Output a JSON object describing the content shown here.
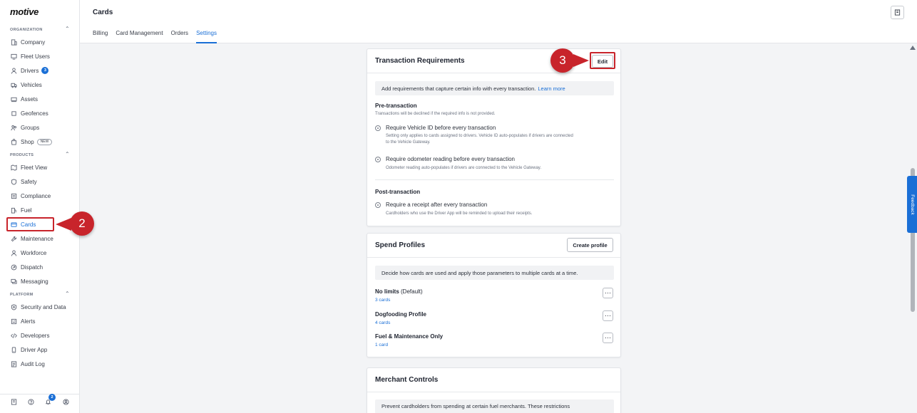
{
  "app": {
    "logo": "motive"
  },
  "sidebar": {
    "sections": [
      {
        "label": "ORGANIZATION"
      },
      {
        "label": "PRODUCTS"
      },
      {
        "label": "PLATFORM"
      }
    ],
    "organization_items": [
      {
        "label": "Company",
        "icon": "building-icon"
      },
      {
        "label": "Fleet Users",
        "icon": "monitor-icon"
      },
      {
        "label": "Drivers",
        "icon": "person-icon",
        "badge": "3"
      },
      {
        "label": "Vehicles",
        "icon": "truck-icon"
      },
      {
        "label": "Assets",
        "icon": "trailer-icon"
      },
      {
        "label": "Geofences",
        "icon": "geofence-icon"
      },
      {
        "label": "Groups",
        "icon": "groups-icon"
      },
      {
        "label": "Shop",
        "icon": "shop-icon",
        "tag": "NEW"
      }
    ],
    "products_items": [
      {
        "label": "Fleet View",
        "icon": "map-icon"
      },
      {
        "label": "Safety",
        "icon": "shield-icon"
      },
      {
        "label": "Compliance",
        "icon": "compliance-icon"
      },
      {
        "label": "Fuel",
        "icon": "fuel-icon"
      },
      {
        "label": "Cards",
        "icon": "card-icon",
        "active": true
      },
      {
        "label": "Maintenance",
        "icon": "wrench-icon"
      },
      {
        "label": "Workforce",
        "icon": "person-icon"
      },
      {
        "label": "Dispatch",
        "icon": "dispatch-icon"
      },
      {
        "label": "Messaging",
        "icon": "chat-icon"
      }
    ],
    "platform_items": [
      {
        "label": "Security and Data",
        "icon": "shield-lock-icon"
      },
      {
        "label": "Alerts",
        "icon": "alert-icon"
      },
      {
        "label": "Developers",
        "icon": "code-icon"
      },
      {
        "label": "Driver App",
        "icon": "phone-icon"
      },
      {
        "label": "Audit Log",
        "icon": "log-icon"
      }
    ],
    "bottom": {
      "notification_count": "2"
    }
  },
  "header": {
    "title": "Cards",
    "tabs": [
      {
        "label": "Billing"
      },
      {
        "label": "Card Management"
      },
      {
        "label": "Orders"
      },
      {
        "label": "Settings",
        "active": true
      }
    ]
  },
  "transaction_requirements": {
    "title": "Transaction Requirements",
    "edit_label": "Edit",
    "info": "Add requirements that capture certain info with every transaction.",
    "learn_more": "Learn more",
    "pre_title": "Pre-transaction",
    "pre_note": "Transactions will be declined if the required info is not provided.",
    "req1_label": "Require Vehicle ID before every transaction",
    "req1_note_1": "Setting only applies to cards assigned to drivers. Vehicle ID auto-populates if drivers are connected",
    "req1_note_2": "to the Vehicle Gateway.",
    "req2_label": "Require odometer reading before every transaction",
    "req2_note": "Odometer reading auto-populates if drivers are connected to the Vehicle Gateway.",
    "post_title": "Post-transaction",
    "req3_label": "Require a receipt after every transaction",
    "req3_note": "Cardholders who use the Driver App will be reminded to upload their receipts."
  },
  "spend_profiles": {
    "title": "Spend Profiles",
    "create_label": "Create profile",
    "info": "Decide how cards are used and apply those parameters to multiple cards at a time.",
    "profiles": [
      {
        "name": "No limits",
        "suffix": "(Default)",
        "count": "3 cards"
      },
      {
        "name": "Dogfooding Profile",
        "suffix": "",
        "count": "4 cards"
      },
      {
        "name": "Fuel & Maintenance Only",
        "suffix": "",
        "count": "1 card"
      }
    ]
  },
  "merchant_controls": {
    "title": "Merchant Controls",
    "info": "Prevent cardholders from spending at certain fuel merchants. These restrictions"
  },
  "annotations": {
    "step2": "2",
    "step3": "3"
  },
  "feedback_label": "Feedback",
  "colors": {
    "accent": "#1a6fd6",
    "annotation": "#c8242b"
  }
}
